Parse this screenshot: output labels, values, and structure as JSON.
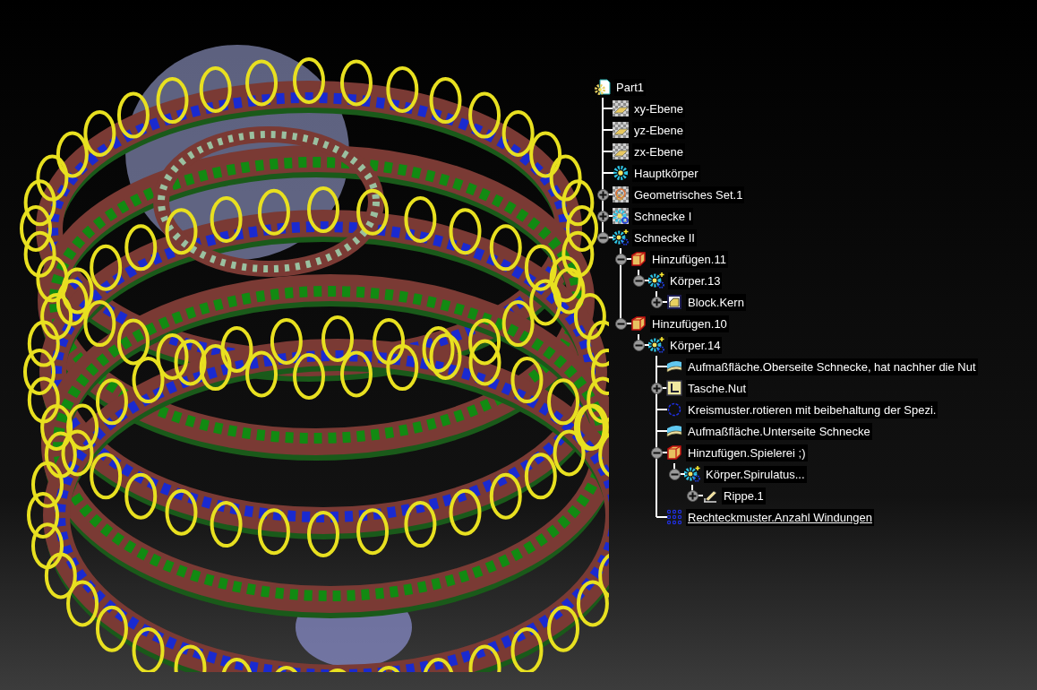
{
  "specification_tree": {
    "label": "Part1",
    "kind": "part",
    "in_work_object": false,
    "children": [
      {
        "label": "xy-Ebene",
        "kind": "plane",
        "in_work_object": false
      },
      {
        "label": "yz-Ebene",
        "kind": "plane",
        "in_work_object": false
      },
      {
        "label": "zx-Ebene",
        "kind": "plane",
        "in_work_object": false
      },
      {
        "label": "Hauptkörper",
        "kind": "body",
        "in_work_object": false
      },
      {
        "label": "Geometrisches Set.1",
        "kind": "geoset",
        "in_work_object": false,
        "expanded": false
      },
      {
        "label": "Schnecke I",
        "kind": "body_hatched",
        "in_work_object": false,
        "expanded": false
      },
      {
        "label": "Schnecke II",
        "kind": "body_new",
        "in_work_object": false,
        "expanded": true,
        "children": [
          {
            "label": "Hinzufügen.11",
            "kind": "add",
            "in_work_object": false,
            "expanded": true,
            "children": [
              {
                "label": "Körper.13",
                "kind": "body_new",
                "in_work_object": false,
                "expanded": true,
                "children": [
                  {
                    "label": "Block.Kern",
                    "kind": "block",
                    "in_work_object": false,
                    "expanded": false
                  }
                ]
              }
            ]
          },
          {
            "label": "Hinzufügen.10",
            "kind": "add",
            "in_work_object": false,
            "expanded": true,
            "children": [
              {
                "label": "Körper.14",
                "kind": "body_new",
                "in_work_object": false,
                "expanded": true,
                "children": [
                  {
                    "label": "Aufmaßfläche.Oberseite Schnecke, hat nachher die Nut",
                    "kind": "thickness",
                    "in_work_object": false
                  },
                  {
                    "label": "Tasche.Nut",
                    "kind": "pocket",
                    "in_work_object": false,
                    "expanded": false
                  },
                  {
                    "label": "Kreismuster.rotieren mit beibehaltung der Spezi.",
                    "kind": "circpattern",
                    "in_work_object": false
                  },
                  {
                    "label": "Aufmaßfläche.Unterseite Schnecke",
                    "kind": "thickness",
                    "in_work_object": false
                  },
                  {
                    "label": "Hinzufügen.Spielerei ;)",
                    "kind": "add",
                    "in_work_object": false,
                    "expanded": true,
                    "children": [
                      {
                        "label": "Körper.Spirulatus...",
                        "kind": "body_new",
                        "in_work_object": false,
                        "expanded": true,
                        "children": [
                          {
                            "label": "Rippe.1",
                            "kind": "rib",
                            "in_work_object": false,
                            "expanded": false
                          }
                        ]
                      }
                    ]
                  },
                  {
                    "label": "Rechteckmuster.Anzahl Windungen",
                    "kind": "rectpattern",
                    "in_work_object": true
                  }
                ]
              }
            ]
          }
        ]
      }
    ]
  }
}
